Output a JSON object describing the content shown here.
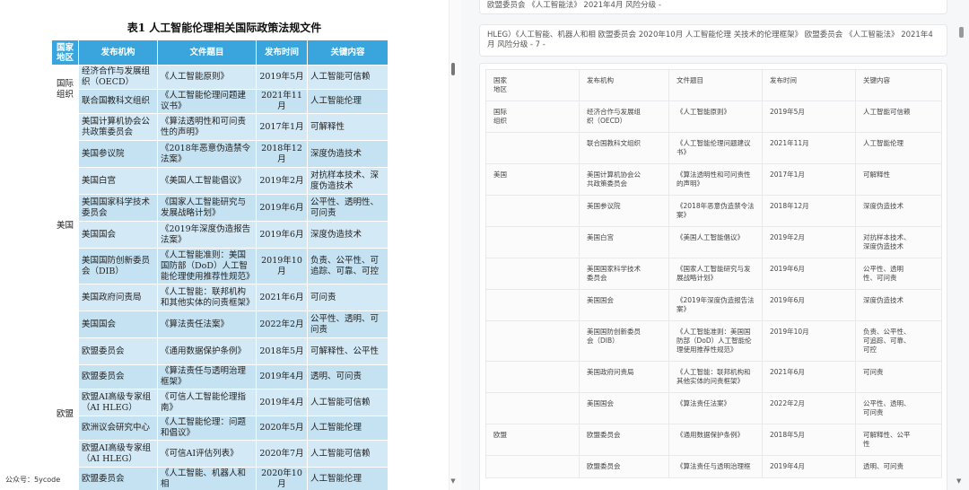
{
  "left": {
    "title": "表1  人工智能伦理相关国际政策法规文件",
    "headers": [
      "国家\n地区",
      "发布机构",
      "文件题目",
      "发布时间",
      "关键内容"
    ],
    "groups": [
      {
        "region": "国际\n组织",
        "rows": [
          {
            "org": "经济合作与发展组织（OECD）",
            "doc": "《人工智能原则》",
            "date": "2019年5月",
            "key": "人工智能可信赖"
          },
          {
            "org": "联合国教科文组织",
            "doc": "《人工智能伦理问题建议书》",
            "date": "2021年11月",
            "key": "人工智能伦理"
          }
        ]
      },
      {
        "region": "美国",
        "rows": [
          {
            "org": "美国计算机协会公共政策委员会",
            "doc": "《算法透明性和可问责性的声明》",
            "date": "2017年1月",
            "key": "可解释性"
          },
          {
            "org": "美国参议院",
            "doc": "《2018年恶意伪造禁令法案》",
            "date": "2018年12月",
            "key": "深度伪造技术"
          },
          {
            "org": "美国白宫",
            "doc": "《美国人工智能倡议》",
            "date": "2019年2月",
            "key": "对抗样本技术、深度伪造技术"
          },
          {
            "org": "美国国家科学技术委员会",
            "doc": "《国家人工智能研究与发展战略计划》",
            "date": "2019年6月",
            "key": "公平性、透明性、可问责"
          },
          {
            "org": "美国国会",
            "doc": "《2019年深度伪造报告法案》",
            "date": "2019年6月",
            "key": "深度伪造技术"
          },
          {
            "org": "美国国防创新委员会（DIB）",
            "doc": "《人工智能准则：美国国防部（DoD）人工智能伦理使用推荐性规范》",
            "date": "2019年10月",
            "key": "负责、公平性、可追踪、可靠、可控"
          },
          {
            "org": "美国政府问责局",
            "doc": "《人工智能：联邦机构和其他实体的问责框架》",
            "date": "2021年6月",
            "key": "可问责"
          },
          {
            "org": "美国国会",
            "doc": "《算法责任法案》",
            "date": "2022年2月",
            "key": "公平性、透明、可问责"
          }
        ]
      },
      {
        "region": "欧盟",
        "rows": [
          {
            "org": "欧盟委员会",
            "doc": "《通用数据保护条例》",
            "date": "2018年5月",
            "key": "可解释性、公平性"
          },
          {
            "org": "欧盟委员会",
            "doc": "《算法责任与透明治理框架》",
            "date": "2019年4月",
            "key": "透明、可问责"
          },
          {
            "org": "欧盟AI高级专家组（AI HLEG）",
            "doc": "《可信人工智能伦理指南》",
            "date": "2019年4月",
            "key": "人工智能可信赖"
          },
          {
            "org": "欧洲议会研究中心",
            "doc": "《人工智能伦理：问题和倡议》",
            "date": "2020年5月",
            "key": "人工智能伦理"
          },
          {
            "org": "欧盟AI高级专家组（AI HLEG）",
            "doc": "《可信AI评估列表》",
            "date": "2020年7月",
            "key": "人工智能可信赖"
          },
          {
            "org": "欧盟委员会",
            "doc": "《人工智能、机器人和相",
            "date": "2020年10月",
            "key": "人工智能伦理"
          }
        ]
      }
    ],
    "watermark": "公众号：5ycode"
  },
  "right": {
    "top_message": "欧盟委员会 《人工智能法》 2021年4月 风险分级 -",
    "message": "HLEG）《人工智能、机器人和相 欧盟委员会 2020年10月 人工智能伦理 关技术的伦理框架》 欧盟委员会 《人工智能法》 2021年4月 风险分级 - 7 -",
    "header": [
      "国家\n地区",
      "发布机构",
      "文件题目",
      "发布时间",
      "关键内容"
    ],
    "rows": [
      {
        "region": "国际\n组织",
        "org": "经济合作与发展组\n织（OECD）",
        "doc": "《人工智能原则》",
        "date": "2019年5月",
        "key": "人工智能可信赖"
      },
      {
        "region": "",
        "org": "联合国教科文组织",
        "doc": "《人工智能伦理问题建议\n书》",
        "date": "2021年11月",
        "key": "人工智能伦理"
      },
      {
        "region": "美国",
        "org": "美国计算机协会公\n共政策委员会",
        "doc": "《算法透明性和可问责性\n的声明》",
        "date": "2017年1月",
        "key": "可解释性"
      },
      {
        "region": "",
        "org": "美国参议院",
        "doc": "《2018年恶意伪造禁令法\n案》",
        "date": "2018年12月",
        "key": "深度伪造技术"
      },
      {
        "region": "",
        "org": "美国白宫",
        "doc": "《美国人工智能倡议》",
        "date": "2019年2月",
        "key": "对抗样本技术、\n深度伪造技术"
      },
      {
        "region": "",
        "org": "美国国家科学技术\n委员会",
        "doc": "《国家人工智能研究与发\n展战略计划》",
        "date": "2019年6月",
        "key": "公平性、透明\n性、可问责"
      },
      {
        "region": "",
        "org": "美国国会",
        "doc": "《2019年深度伪造报告法\n案》",
        "date": "2019年6月",
        "key": "深度伪造技术"
      },
      {
        "region": "",
        "org": "美国国防创新委员\n会（DIB）",
        "doc": "《人工智能准则：美国国\n防部（DoD）人工智能伦\n理使用推荐性规范》",
        "date": "2019年10月",
        "key": "负责、公平性、\n可追踪、可靠、\n可控"
      },
      {
        "region": "",
        "org": "美国政府问责局",
        "doc": "《人工智能：联邦机构和\n其他实体的问责框架》",
        "date": "2021年6月",
        "key": "可问责"
      },
      {
        "region": "",
        "org": "美国国会",
        "doc": "《算法责任法案》",
        "date": "2022年2月",
        "key": "公平性、透明、\n可问责"
      },
      {
        "region": "欧盟",
        "org": "欧盟委员会",
        "doc": "《通用数据保护条例》",
        "date": "2018年5月",
        "key": "可解释性、公平\n性"
      },
      {
        "region": "",
        "org": "欧盟委员会",
        "doc": "《算法责任与透明治理框",
        "date": "2019年4月",
        "key": "透明、可问责"
      }
    ]
  }
}
